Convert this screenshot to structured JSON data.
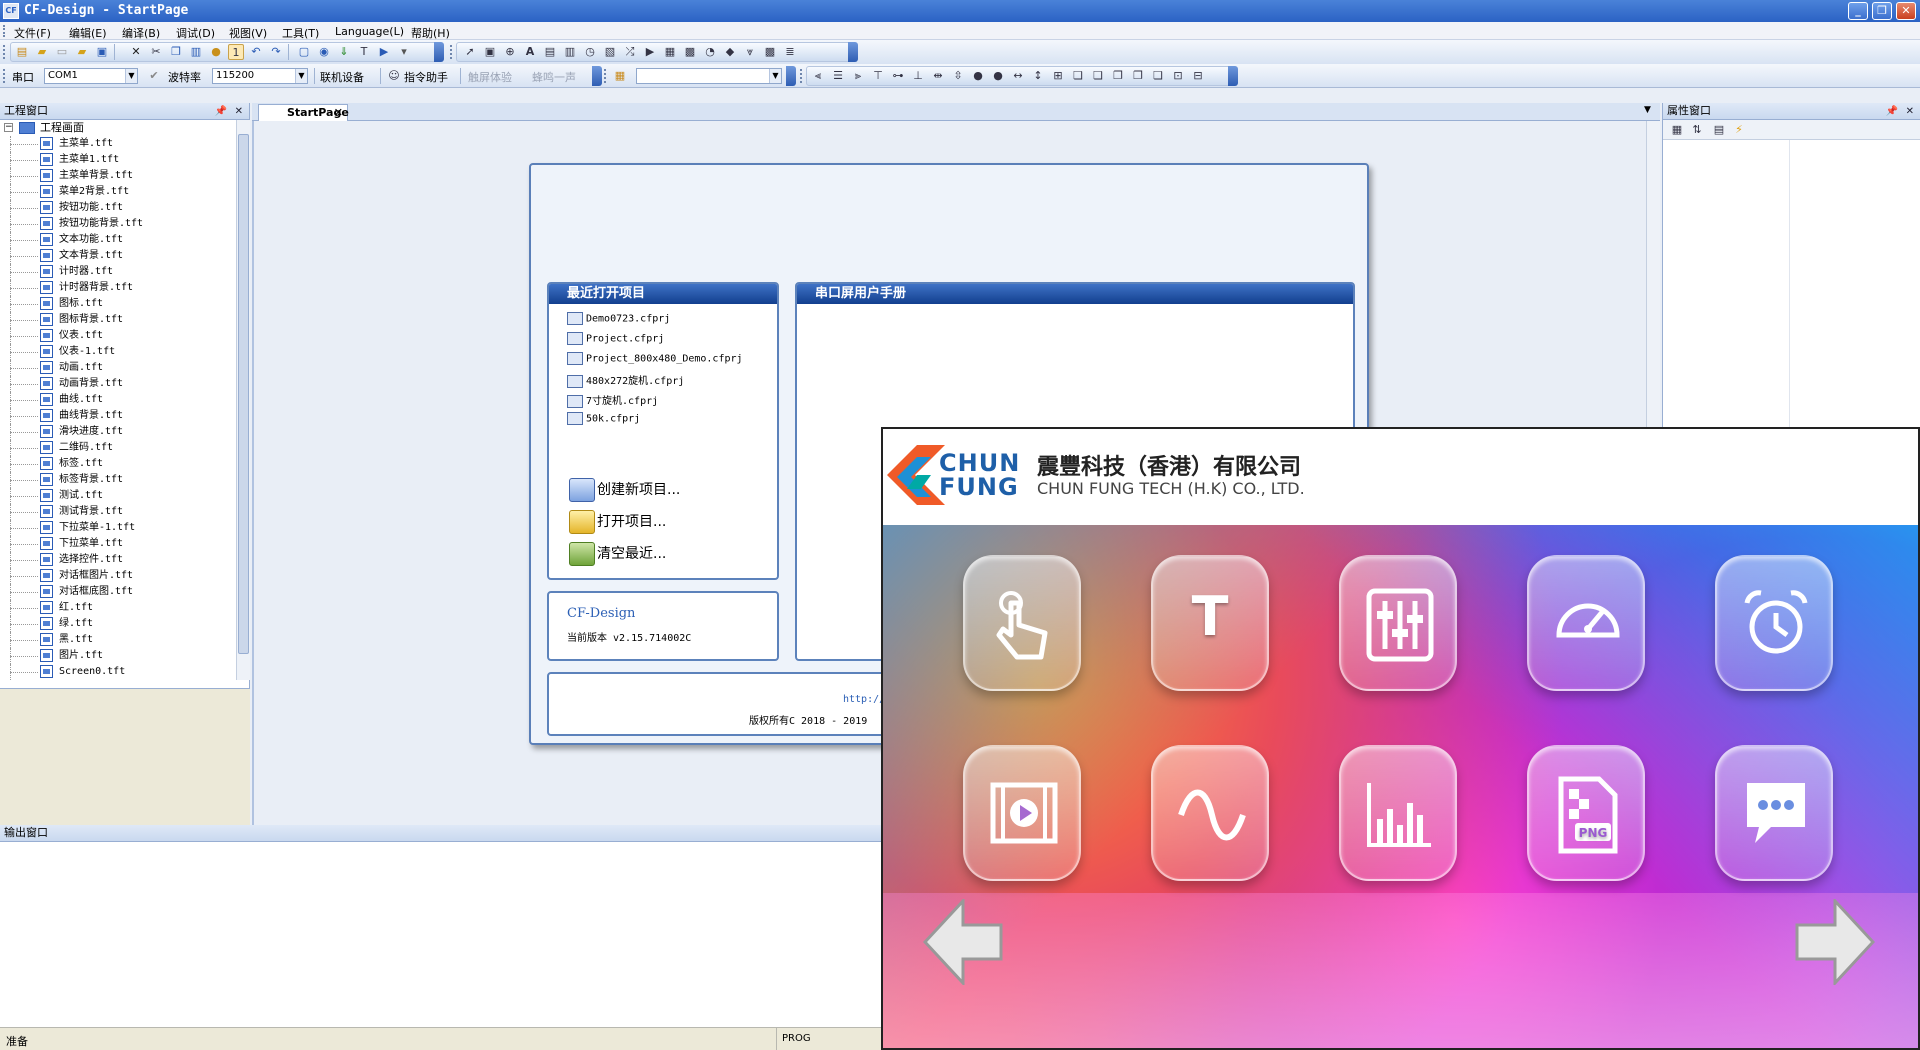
{
  "window": {
    "title": "CF-Design - StartPage",
    "icon_text": "CF"
  },
  "menu": [
    "文件(F)",
    "编辑(E)",
    "编译(B)",
    "调试(D)",
    "视图(V)",
    "工具(T)",
    "Language(L)",
    "帮助(H)"
  ],
  "toolbar2": {
    "port_label": "串口",
    "port_value": "COM1",
    "baud_label": "波特率",
    "baud_value": "115200",
    "connect_label": "联机设备",
    "assistant_label": "指令助手",
    "disabled1": "触屏体验",
    "disabled2": "蜂鸣一声"
  },
  "project_panel": {
    "title": "工程窗口",
    "root": "工程画面",
    "files": [
      "主菜单.tft",
      "主菜单1.tft",
      "主菜单背景.tft",
      "菜单2背景.tft",
      "按钮功能.tft",
      "按钮功能背景.tft",
      "文本功能.tft",
      "文本背景.tft",
      "计时器.tft",
      "计时器背景.tft",
      "图标.tft",
      "图标背景.tft",
      "仪表.tft",
      "仪表-1.tft",
      "动画.tft",
      "动画背景.tft",
      "曲线.tft",
      "曲线背景.tft",
      "滑块进度.tft",
      "二维码.tft",
      "标签.tft",
      "标签背景.tft",
      "测试.tft",
      "测试背景.tft",
      "下拉菜单-1.tft",
      "下拉菜单.tft",
      "选择控件.tft",
      "对话框图片.tft",
      "对话框底图.tft",
      "红.tft",
      "绿.tft",
      "黑.tft",
      "图片.tft",
      "Screen0.tft"
    ]
  },
  "doc": {
    "tab": "StartPage",
    "recent_title": "最近打开项目",
    "recent": [
      "Demo0723.cfprj",
      "Project.cfprj",
      "Project_800x480_Demo.cfprj",
      "480x272旋机.cfprj",
      "7寸旋机.cfprj",
      "50k.cfprj"
    ],
    "actions": [
      "创建新项目...",
      "打开项目...",
      "清空最近..."
    ],
    "manual_title": "串口屏用户手册",
    "product": "CF-Design",
    "version": "当前版本 v2.15.714002C",
    "url": "http://w",
    "copyright": "版权所有C 2018 - 2019 "
  },
  "props_panel": {
    "title": "属性窗口"
  },
  "output_panel": {
    "title": "输出窗口"
  },
  "status": {
    "left": "准备",
    "mode": "PROG"
  },
  "device": {
    "logo_line1": "CHUN",
    "logo_line2": "FUNG",
    "company_cn": "震豐科技（香港）有限公司",
    "company_en": "CHUN FUNG TECH (H.K) CO., LTD.",
    "icons": [
      "touch-icon",
      "text-icon",
      "slider-icon",
      "gauge-icon",
      "alarm-clock-icon",
      "video-icon",
      "wave-icon",
      "bar-chart-icon",
      "png-image-icon",
      "chat-icon"
    ],
    "text_button_glyph": "T",
    "png_label": "PNG"
  },
  "colors": {
    "accent": "#2b62c4",
    "panel_head": "#123f8e",
    "logo_orange": "#f05a28",
    "logo_blue": "#1e90d6",
    "logo_teal": "#00a9a5"
  }
}
